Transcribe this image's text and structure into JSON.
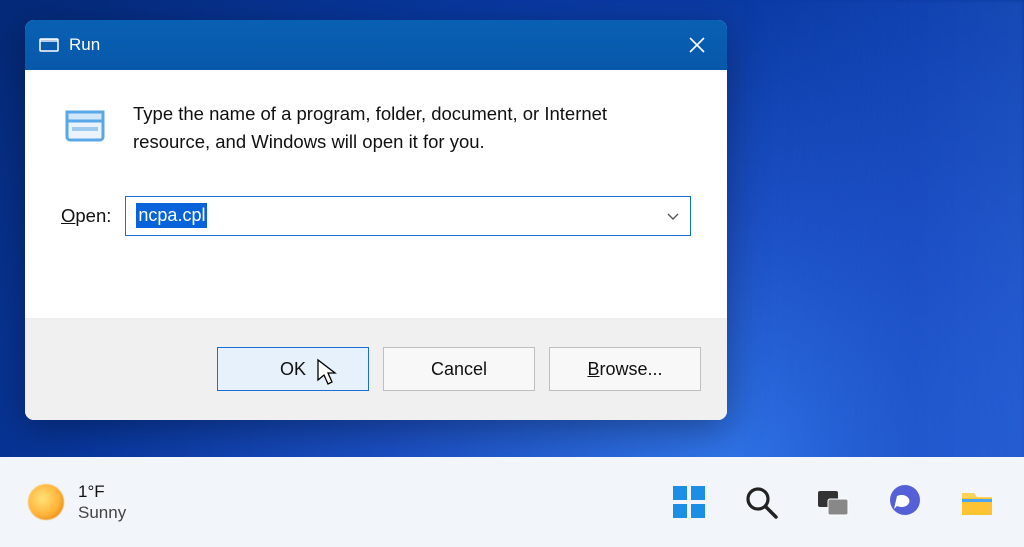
{
  "dialog": {
    "title": "Run",
    "instruction": "Type the name of a program, folder, document, or Internet resource, and Windows will open it for you.",
    "open_label_prefix": "O",
    "open_label_rest": "pen:",
    "open_value": "ncpa.cpl",
    "buttons": {
      "ok": "OK",
      "cancel": "Cancel",
      "browse_prefix": "B",
      "browse_rest": "rowse..."
    }
  },
  "taskbar": {
    "temperature": "1°F",
    "condition": "Sunny"
  }
}
